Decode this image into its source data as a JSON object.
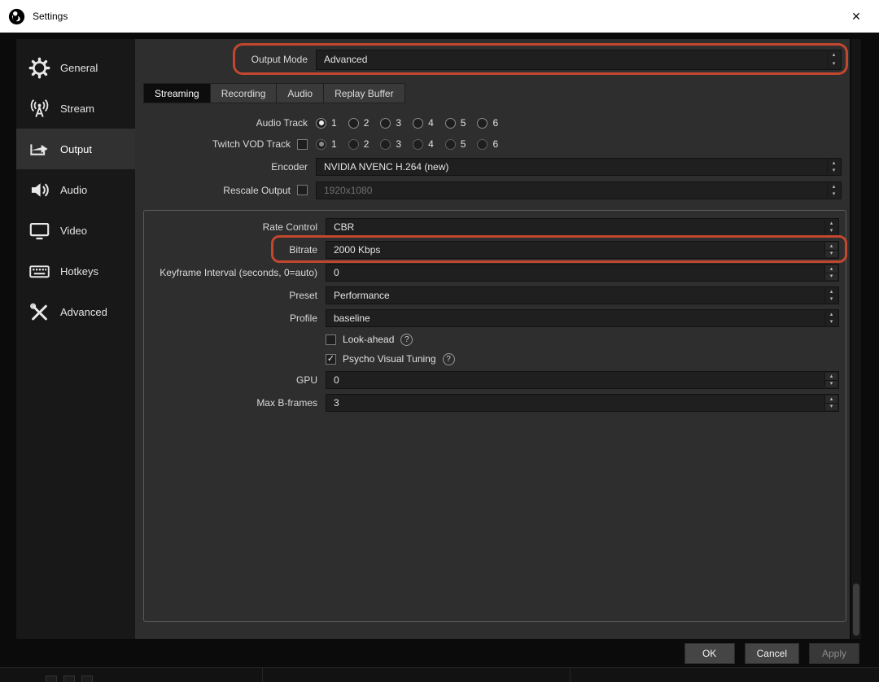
{
  "window": {
    "title": "Settings"
  },
  "icons": {
    "close": "✕",
    "spin_up": "▴",
    "spin_down": "▾",
    "check": "✓",
    "help": "?"
  },
  "sidebar": {
    "items": [
      {
        "label": "General",
        "icon": "gear-icon",
        "selected": false
      },
      {
        "label": "Stream",
        "icon": "broadcast-icon",
        "selected": false
      },
      {
        "label": "Output",
        "icon": "output-arrow-icon",
        "selected": true
      },
      {
        "label": "Audio",
        "icon": "speaker-icon",
        "selected": false
      },
      {
        "label": "Video",
        "icon": "monitor-icon",
        "selected": false
      },
      {
        "label": "Hotkeys",
        "icon": "keyboard-icon",
        "selected": false
      },
      {
        "label": "Advanced",
        "icon": "tools-icon",
        "selected": false
      }
    ]
  },
  "output_mode": {
    "label": "Output Mode",
    "value": "Advanced"
  },
  "tabs": [
    {
      "label": "Streaming",
      "active": true
    },
    {
      "label": "Recording",
      "active": false
    },
    {
      "label": "Audio",
      "active": false
    },
    {
      "label": "Replay Buffer",
      "active": false
    }
  ],
  "form": {
    "audio_track": {
      "label": "Audio Track",
      "options": [
        "1",
        "2",
        "3",
        "4",
        "5",
        "6"
      ],
      "selected": "1"
    },
    "twitch_vod": {
      "label": "Twitch VOD Track",
      "checked": false,
      "options": [
        "1",
        "2",
        "3",
        "4",
        "5",
        "6"
      ],
      "selected": "1"
    },
    "encoder": {
      "label": "Encoder",
      "value": "NVIDIA NVENC H.264 (new)"
    },
    "rescale_output": {
      "label": "Rescale Output",
      "checked": false,
      "value": "1920x1080",
      "disabled": true
    }
  },
  "encoder_settings": {
    "rate_control": {
      "label": "Rate Control",
      "value": "CBR"
    },
    "bitrate": {
      "label": "Bitrate",
      "value": "2000 Kbps"
    },
    "keyframe_interval": {
      "label": "Keyframe Interval (seconds, 0=auto)",
      "value": "0"
    },
    "preset": {
      "label": "Preset",
      "value": "Performance"
    },
    "profile": {
      "label": "Profile",
      "value": "baseline"
    },
    "look_ahead": {
      "label": "Look-ahead",
      "checked": false
    },
    "psycho_visual_tuning": {
      "label": "Psycho Visual Tuning",
      "checked": true
    },
    "gpu": {
      "label": "GPU",
      "value": "0"
    },
    "max_bframes": {
      "label": "Max B-frames",
      "value": "3"
    }
  },
  "buttons": {
    "ok": "OK",
    "cancel": "Cancel",
    "apply": "Apply"
  },
  "annotation": {
    "color": "#c2472e"
  }
}
